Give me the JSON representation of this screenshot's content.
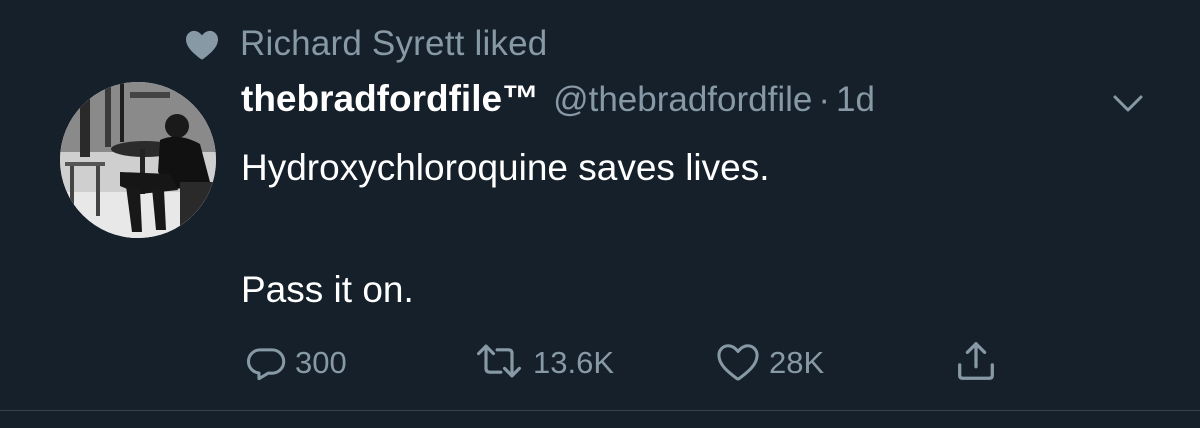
{
  "social_context": {
    "icon": "heart-filled-icon",
    "text": "Richard Syrett liked"
  },
  "tweet": {
    "avatar": "avatar-photo",
    "display_name": "thebradfordfile™",
    "handle": "@thebradfordfile",
    "separator": "·",
    "time": "1d",
    "text_lines": [
      "Hydroxychloroquine saves lives.",
      "Pass it on."
    ],
    "actions": {
      "reply": {
        "icon": "reply-icon",
        "count": "300"
      },
      "retweet": {
        "icon": "retweet-icon",
        "count": "13.6K"
      },
      "like": {
        "icon": "heart-icon",
        "count": "28K"
      },
      "share": {
        "icon": "share-icon"
      }
    }
  },
  "colors": {
    "background": "#15202b",
    "primary_text": "#ffffff",
    "secondary_text": "#8899a6",
    "divider": "#38444d"
  }
}
